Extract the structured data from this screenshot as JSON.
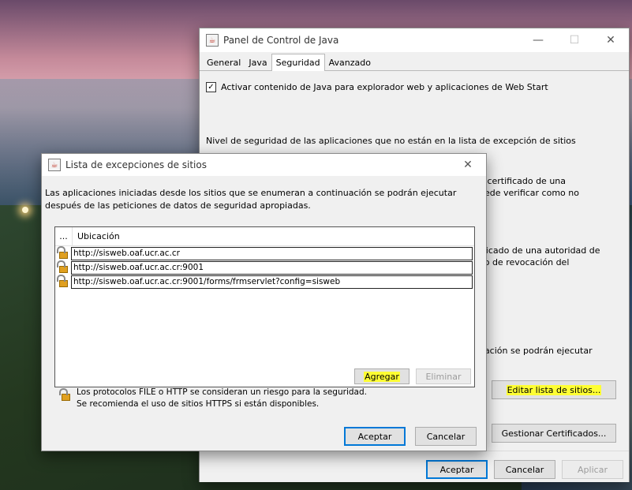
{
  "main_window": {
    "title": "Panel de Control de Java",
    "tabs": [
      "General",
      "Java",
      "Seguridad",
      "Avanzado"
    ],
    "active_tab": "Seguridad",
    "enable_java_label": "Activar contenido de Java para explorador web y aplicaciones de Web Start",
    "enable_java_checked": true,
    "security_level_label": "Nivel de seguridad de las aplicaciones que no están en la lista de excepción de sitios",
    "partial_text_1a": "un certificado de una",
    "partial_text_1b": "puede verificar como no",
    "partial_text_2a": "rtificado de una autoridad de",
    "partial_text_2b": "ado de revocación del",
    "partial_text_3": "nuación se podrán ejecutar",
    "edit_sites_button": "Editar lista de sitios...",
    "manage_certs_button": "Gestionar Certificados...",
    "ok_button": "Aceptar",
    "cancel_button": "Cancelar",
    "apply_button": "Aplicar",
    "minimize_symbol": "—",
    "maximize_symbol": "☐",
    "close_symbol": "✕"
  },
  "dialog": {
    "title": "Lista de excepciones de sitios",
    "description": "Las aplicaciones iniciadas desde los sitios que se enumeran a continuación se podrán ejecutar después de las peticiones de datos de seguridad apropiadas.",
    "table_headers": [
      "...",
      "Ubicación"
    ],
    "sites": [
      "http://sisweb.oaf.ucr.ac.cr",
      "http://sisweb.oaf.ucr.ac.cr:9001",
      "http://sisweb.oaf.ucr.ac.cr:9001/forms/frmservlet?config=sisweb"
    ],
    "add_button": "Agregar",
    "remove_button": "Eliminar",
    "note_line1": "Los protocolos FILE o HTTP se consideran un riesgo para la seguridad.",
    "note_line2": "Se recomienda el uso de sitios HTTPS si están disponibles.",
    "ok_button": "Aceptar",
    "cancel_button": "Cancelar",
    "close_symbol": "✕"
  },
  "icons": {
    "java": "java-cup-icon",
    "lock": "lock-icon"
  },
  "colors": {
    "highlight": "#ffff33",
    "primary_border": "#0078d7"
  }
}
